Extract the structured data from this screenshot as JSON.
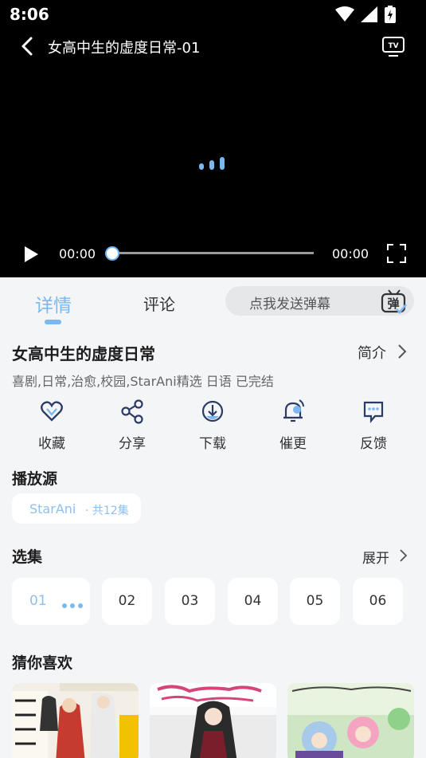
{
  "status": {
    "time": "8:06"
  },
  "player": {
    "title": "女高中生的虚度日常-01",
    "current_time": "00:00",
    "total_time": "00:00",
    "progress": 0
  },
  "tabs": {
    "detail": "详情",
    "comment": "评论"
  },
  "danmaku": {
    "placeholder": "点我发送弹幕",
    "icon_glyph": "弹"
  },
  "info": {
    "title": "女高中生的虚度日常",
    "intro_label": "简介",
    "tags": "喜剧,日常,治愈,校园,StarAni精选 日语 已完结"
  },
  "actions": [
    {
      "label": "收藏",
      "icon": "heart-icon"
    },
    {
      "label": "分享",
      "icon": "share-icon"
    },
    {
      "label": "下载",
      "icon": "download-icon"
    },
    {
      "label": "催更",
      "icon": "bell-icon"
    },
    {
      "label": "反馈",
      "icon": "feedback-icon"
    }
  ],
  "source": {
    "heading": "播放源",
    "name": "StarAni",
    "count": "· 共12集"
  },
  "episodes": {
    "heading": "选集",
    "expand_label": "展开",
    "items": [
      "01",
      "02",
      "03",
      "04",
      "05",
      "06"
    ],
    "active": "01"
  },
  "recommend": {
    "heading": "猜你喜欢"
  },
  "colors": {
    "accent": "#7ab8ef",
    "background": "#f4f5f7",
    "player_bg": "#000000"
  }
}
